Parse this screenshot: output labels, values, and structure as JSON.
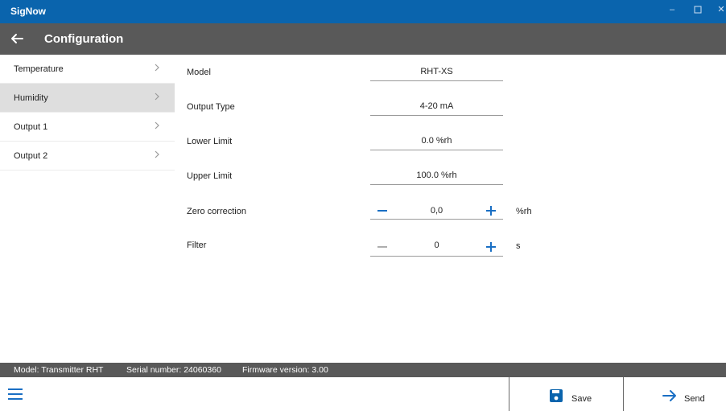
{
  "window": {
    "title": "SigNow"
  },
  "header": {
    "title": "Configuration"
  },
  "sidebar": {
    "items": [
      {
        "label": "Temperature"
      },
      {
        "label": "Humidity"
      },
      {
        "label": "Output 1"
      },
      {
        "label": "Output 2"
      }
    ],
    "active_index": 1
  },
  "form": {
    "model": {
      "label": "Model",
      "value": "RHT-XS"
    },
    "output_type": {
      "label": "Output Type",
      "value": "4-20 mA"
    },
    "lower_limit": {
      "label": "Lower Limit",
      "value": "0.0 %rh"
    },
    "upper_limit": {
      "label": "Upper Limit",
      "value": "100.0 %rh"
    },
    "zero_correction": {
      "label": "Zero correction",
      "value": "0,0",
      "unit": "%rh"
    },
    "filter": {
      "label": "Filter",
      "value": "0",
      "unit": "s"
    }
  },
  "status": {
    "model": "Model: Transmitter RHT",
    "serial": "Serial number: 24060360",
    "firmware": "Firmware version: 3.00"
  },
  "actions": {
    "save_label": "Save",
    "send_label": "Send"
  },
  "colors": {
    "titlebar": "#0a64ad",
    "header": "#595959",
    "accent": "#1a6fc4",
    "active_nav": "#dedede"
  }
}
